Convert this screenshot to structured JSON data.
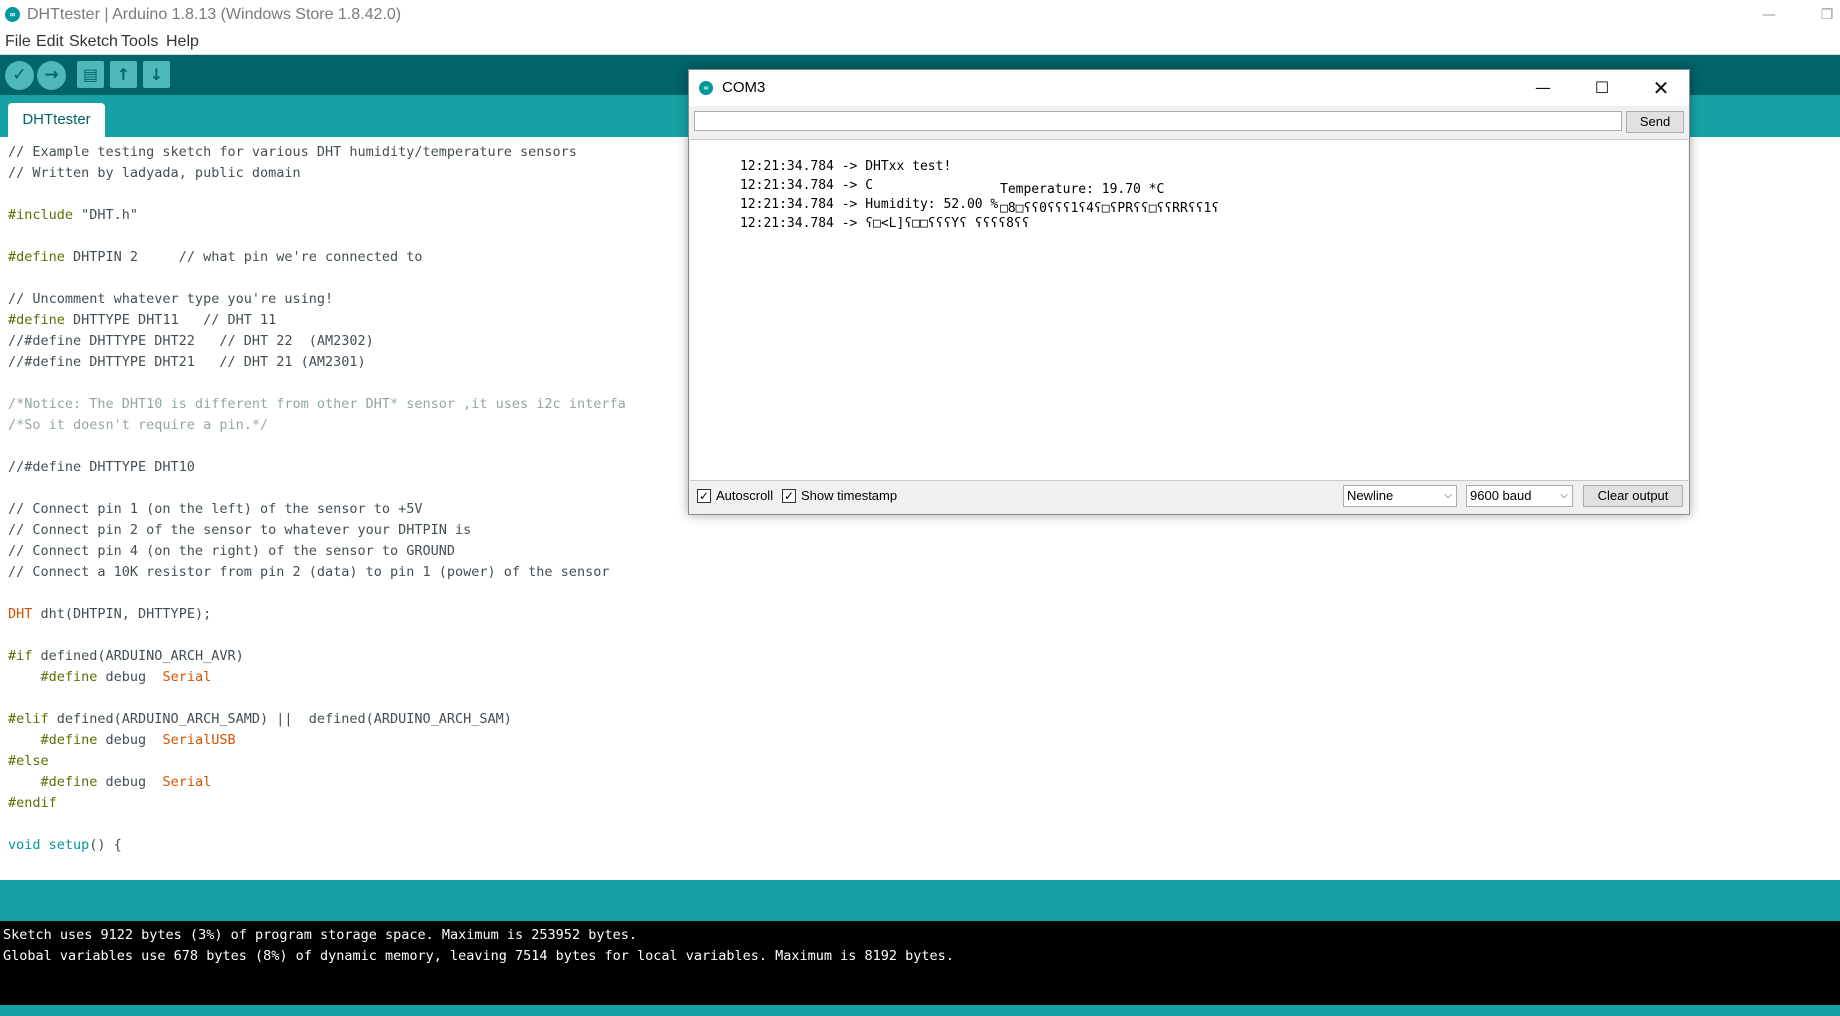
{
  "window": {
    "title": "DHTtester | Arduino 1.8.13 (Windows Store 1.8.42.0)"
  },
  "menu": [
    "File",
    "Edit",
    "Sketch",
    "Tools",
    "Help"
  ],
  "toolbar": {
    "verify_icon": "✓",
    "upload_icon": "→",
    "new_icon": "▤",
    "open_icon": "↑",
    "save_icon": "↓"
  },
  "tabs": [
    {
      "label": "DHTtester"
    }
  ],
  "code_lines": [
    [
      [
        "// Example testing sketch for various DHT humidity/temperature sensors",
        "k-comment"
      ]
    ],
    [
      [
        "// Written by ladyada, public domain",
        "k-comment"
      ]
    ],
    [],
    [
      [
        "#include",
        "k-pre"
      ],
      [
        " \"DHT.h\"",
        "k-comment"
      ]
    ],
    [],
    [
      [
        "#define",
        "k-pre"
      ],
      [
        " DHTPIN 2     ",
        ""
      ],
      [
        "// what pin we're connected to",
        "k-comment"
      ]
    ],
    [],
    [
      [
        "// Uncomment whatever type you're using!",
        "k-comment"
      ]
    ],
    [
      [
        "#define",
        "k-pre"
      ],
      [
        " DHTTYPE DHT11   ",
        ""
      ],
      [
        "// DHT 11",
        "k-comment"
      ]
    ],
    [
      [
        "//#define DHTTYPE DHT22   // DHT 22  (AM2302)",
        "k-comment"
      ]
    ],
    [
      [
        "//#define DHTTYPE DHT21   // DHT 21 (AM2301)",
        "k-comment"
      ]
    ],
    [],
    [
      [
        "/*Notice: The DHT10 is different from other DHT* sensor ,it uses i2c interfa",
        "k-fade"
      ]
    ],
    [
      [
        "/*So it doesn't require a pin.*/",
        "k-fade"
      ]
    ],
    [],
    [
      [
        "//#define DHTTYPE DHT10",
        "k-comment"
      ]
    ],
    [],
    [
      [
        "// Connect pin 1 (on the left) of the sensor to +5V",
        "k-comment"
      ]
    ],
    [
      [
        "// Connect pin 2 of the sensor to whatever your DHTPIN is",
        "k-comment"
      ]
    ],
    [
      [
        "// Connect pin 4 (on the right) of the sensor to GROUND",
        "k-comment"
      ]
    ],
    [
      [
        "// Connect a 10K resistor from pin 2 (data) to pin 1 (power) of the sensor",
        "k-comment"
      ]
    ],
    [],
    [
      [
        "DHT",
        "k-type"
      ],
      [
        " dht(DHTPIN, DHTTYPE);",
        ""
      ]
    ],
    [],
    [
      [
        "#if",
        "k-pre"
      ],
      [
        " defined(ARDUINO_ARCH_AVR)",
        ""
      ]
    ],
    [
      [
        "    #define",
        "k-pre"
      ],
      [
        " debug  ",
        ""
      ],
      [
        "Serial",
        "k-type"
      ]
    ],
    [],
    [
      [
        "#elif",
        "k-pre"
      ],
      [
        " defined(ARDUINO_ARCH_SAMD) ||  defined(ARDUINO_ARCH_SAM)",
        ""
      ]
    ],
    [
      [
        "    #define",
        "k-pre"
      ],
      [
        " debug  ",
        ""
      ],
      [
        "SerialUSB",
        "k-type"
      ]
    ],
    [
      [
        "#else",
        "k-pre"
      ]
    ],
    [
      [
        "    #define",
        "k-pre"
      ],
      [
        " debug  ",
        ""
      ],
      [
        "Serial",
        "k-type"
      ]
    ],
    [
      [
        "#endif",
        "k-pre"
      ]
    ],
    [],
    [
      [
        "void",
        "k-kw"
      ],
      [
        " ",
        ""
      ],
      [
        "setup",
        "k-kw"
      ],
      [
        "() {",
        ""
      ]
    ]
  ],
  "console": {
    "lines": [
      "Sketch uses 9122 bytes (3%) of program storage space. Maximum is 253952 bytes.",
      "Global variables use 678 bytes (8%) of dynamic memory, leaving 7514 bytes for local variables. Maximum is 8192 bytes."
    ]
  },
  "serial_monitor": {
    "title": "COM3",
    "input_value": "",
    "send_label": "Send",
    "output": [
      [
        "12:21:34.784 -> DHTxx test!",
        ""
      ],
      [
        "12:21:34.784 -> C",
        ""
      ],
      [
        "12:21:34.784 -> Humidity: 52.00 %",
        "Temperature: 19.70 *C"
      ],
      [
        "12:21:34.784 -> ʕ□<L]ʕ□□ʕʕʕYʕ ʕʕʕʕ8ʕʕ",
        "□8□ʕʕ0ʕʕʕ1ʕ4ʕ□ʕPRʕʕ□ʕʕRRʕʕ1ʕ"
      ]
    ],
    "autoscroll_label": "Autoscroll",
    "autoscroll_checked": true,
    "timestamp_label": "Show timestamp",
    "timestamp_checked": true,
    "line_ending": "Newline",
    "baud": "9600 baud",
    "clear_label": "Clear output"
  },
  "colors": {
    "toolbar": "#006468",
    "tabbar": "#17a1a5",
    "console_bg": "#000000",
    "preprocessor": "#5e6d03",
    "type": "#d35400",
    "keyword": "#00979c"
  }
}
